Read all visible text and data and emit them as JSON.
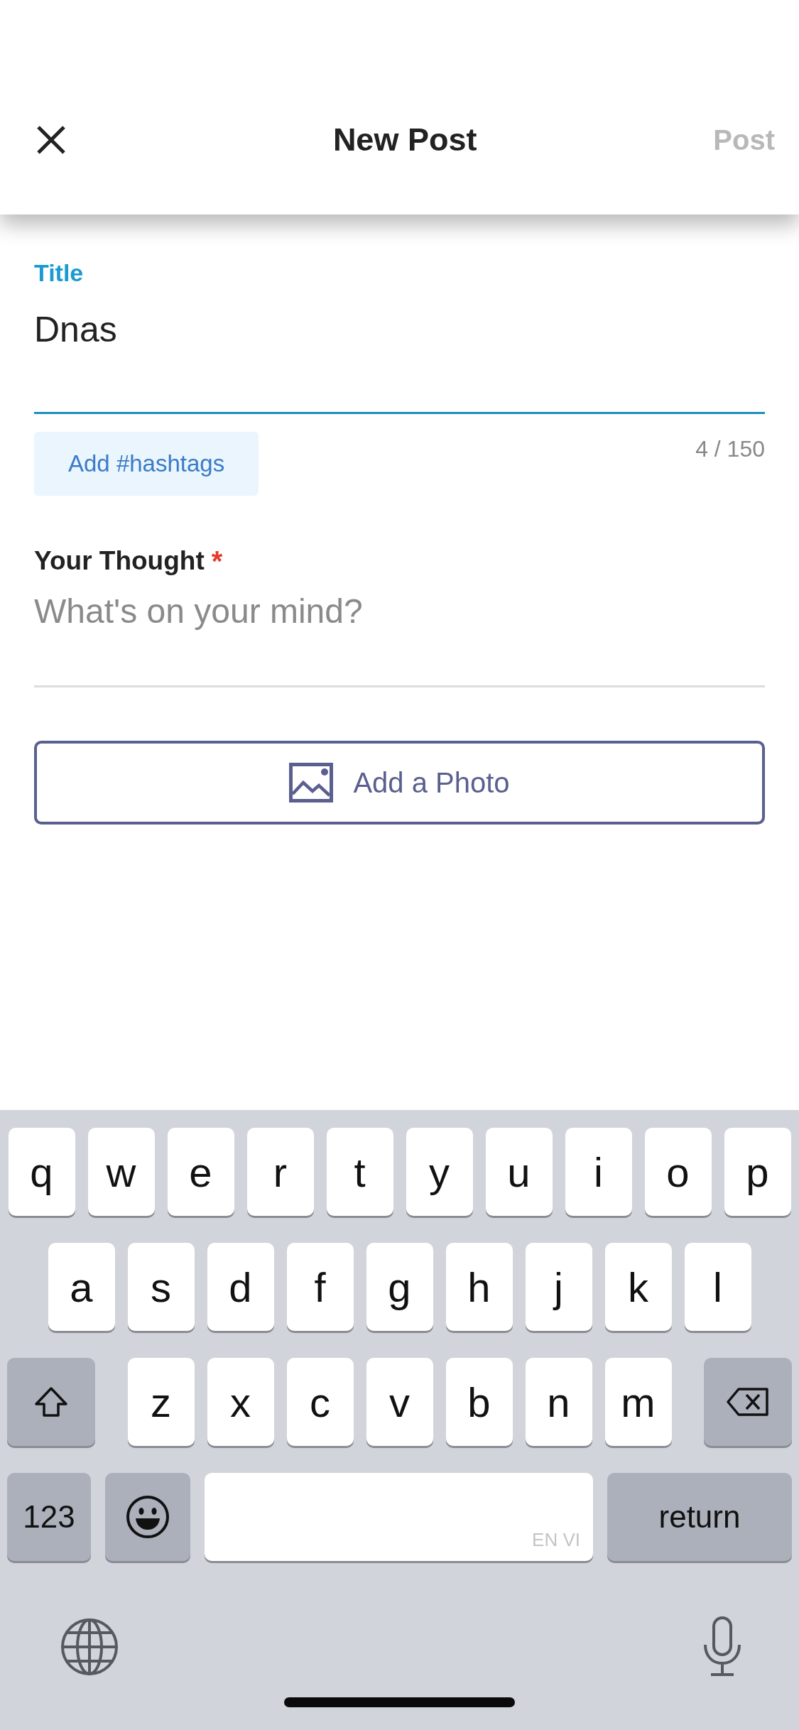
{
  "header": {
    "title": "New Post",
    "post": {
      "label": "Post",
      "disabled": true
    }
  },
  "title_field": {
    "label": "Title",
    "value": "Dnas",
    "focused": true,
    "counter": "4 / 150"
  },
  "hashtag_button": {
    "label": "Add #hashtags"
  },
  "thought_field": {
    "label": "Your Thought",
    "required_mark": "*",
    "placeholder": "What's on your mind?",
    "focused": false
  },
  "photo_button": {
    "label": "Add a Photo"
  },
  "keyboard": {
    "rows": [
      {
        "keys": [
          {
            "kind": "letter",
            "label": "q"
          },
          {
            "kind": "letter",
            "label": "w"
          },
          {
            "kind": "letter",
            "label": "e"
          },
          {
            "kind": "letter",
            "label": "r"
          },
          {
            "kind": "letter",
            "label": "t"
          },
          {
            "kind": "letter",
            "label": "y"
          },
          {
            "kind": "letter",
            "label": "u"
          },
          {
            "kind": "letter",
            "label": "i"
          },
          {
            "kind": "letter",
            "label": "o"
          },
          {
            "kind": "letter",
            "label": "p"
          }
        ]
      },
      {
        "keys": [
          {
            "kind": "letter",
            "label": "a"
          },
          {
            "kind": "letter",
            "label": "s"
          },
          {
            "kind": "letter",
            "label": "d"
          },
          {
            "kind": "letter",
            "label": "f"
          },
          {
            "kind": "letter",
            "label": "g"
          },
          {
            "kind": "letter",
            "label": "h"
          },
          {
            "kind": "letter",
            "label": "j"
          },
          {
            "kind": "letter",
            "label": "k"
          },
          {
            "kind": "letter",
            "label": "l"
          }
        ]
      },
      {
        "keys": [
          {
            "kind": "shift"
          },
          {
            "kind": "letter",
            "label": "z"
          },
          {
            "kind": "letter",
            "label": "x"
          },
          {
            "kind": "letter",
            "label": "c"
          },
          {
            "kind": "letter",
            "label": "v"
          },
          {
            "kind": "letter",
            "label": "b"
          },
          {
            "kind": "letter",
            "label": "n"
          },
          {
            "kind": "letter",
            "label": "m"
          },
          {
            "kind": "backspace"
          }
        ]
      },
      {
        "keys": [
          {
            "kind": "numbers",
            "label": "123"
          },
          {
            "kind": "emoji"
          },
          {
            "kind": "space",
            "label": "EN VI"
          },
          {
            "kind": "return",
            "label": "return"
          }
        ]
      }
    ]
  }
}
